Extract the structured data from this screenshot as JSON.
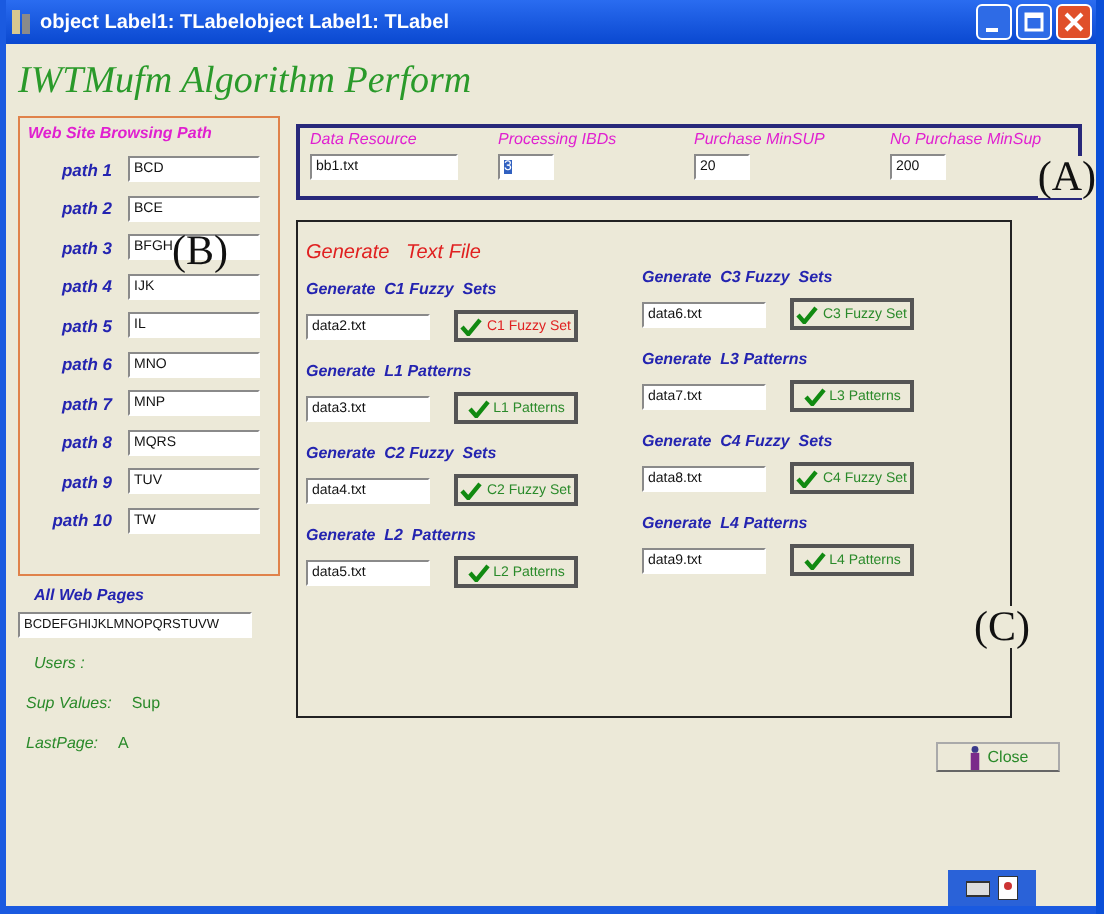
{
  "window": {
    "title": "object Label1: TLabelobject Label1: TLabel"
  },
  "heading": "IWTMufm Algorithm Perform",
  "browsing_paths": {
    "title": "Web Site Browsing Path",
    "annotation": "(B)",
    "paths": [
      {
        "label": "path 1",
        "value": "BCD"
      },
      {
        "label": "path 2",
        "value": "BCE"
      },
      {
        "label": "path 3",
        "value": "BFGH"
      },
      {
        "label": "path 4",
        "value": "IJK"
      },
      {
        "label": "path 5",
        "value": "IL"
      },
      {
        "label": "path 6",
        "value": "MNO"
      },
      {
        "label": "path 7",
        "value": "MNP"
      },
      {
        "label": "path 8",
        "value": "MQRS"
      },
      {
        "label": "path 9",
        "value": "TUV"
      },
      {
        "label": "path 10",
        "value": "TW"
      }
    ]
  },
  "all_web_pages": {
    "label": "All Web Pages",
    "value": "BCDEFGHIJKLMNOPQRSTUVW"
  },
  "results": [
    {
      "label": "Users :"
    },
    {
      "label": "Sup Values:",
      "value": "Sup"
    },
    {
      "label": "LastPage:",
      "value": "A"
    }
  ],
  "parameters": {
    "annotation": "(A)",
    "fields": [
      {
        "label": "Data Resource",
        "value": "bb1.txt",
        "text_selected": false
      },
      {
        "label": "Processing IBDs",
        "value": "3",
        "text_selected": true
      },
      {
        "label": "Purchase MinSUP",
        "value": "20",
        "text_selected": false
      },
      {
        "label": "No Purchase MinSup",
        "value": "200",
        "text_selected": false
      }
    ]
  },
  "generate": {
    "title": "Generate   Text File",
    "annotation": "(C)",
    "columns": [
      [
        {
          "heading": "Generate  C1 Fuzzy  Sets",
          "file": "data2.txt",
          "button": "C1  Fuzzy Set",
          "active": true
        },
        {
          "heading": "Generate  L1 Patterns",
          "file": "data3.txt",
          "button": "L1 Patterns",
          "active": false
        },
        {
          "heading": "Generate  C2 Fuzzy  Sets",
          "file": "data4.txt",
          "button": "C2 Fuzzy Set",
          "active": false
        },
        {
          "heading": "Generate  L2  Patterns",
          "file": "data5.txt",
          "button": "L2 Patterns",
          "active": false
        }
      ],
      [
        {
          "heading": "Generate  C3 Fuzzy  Sets",
          "file": "data6.txt",
          "button": "C3 Fuzzy Set",
          "active": false
        },
        {
          "heading": "Generate  L3 Patterns",
          "file": "data7.txt",
          "button": "L3 Patterns",
          "active": false
        },
        {
          "heading": "Generate  C4 Fuzzy  Sets",
          "file": "data8.txt",
          "button": "C4 Fuzzy Set",
          "active": false
        },
        {
          "heading": "Generate  L4 Patterns",
          "file": "data9.txt",
          "button": "L4 Patterns",
          "active": false
        }
      ]
    ]
  },
  "close_button": "Close"
}
